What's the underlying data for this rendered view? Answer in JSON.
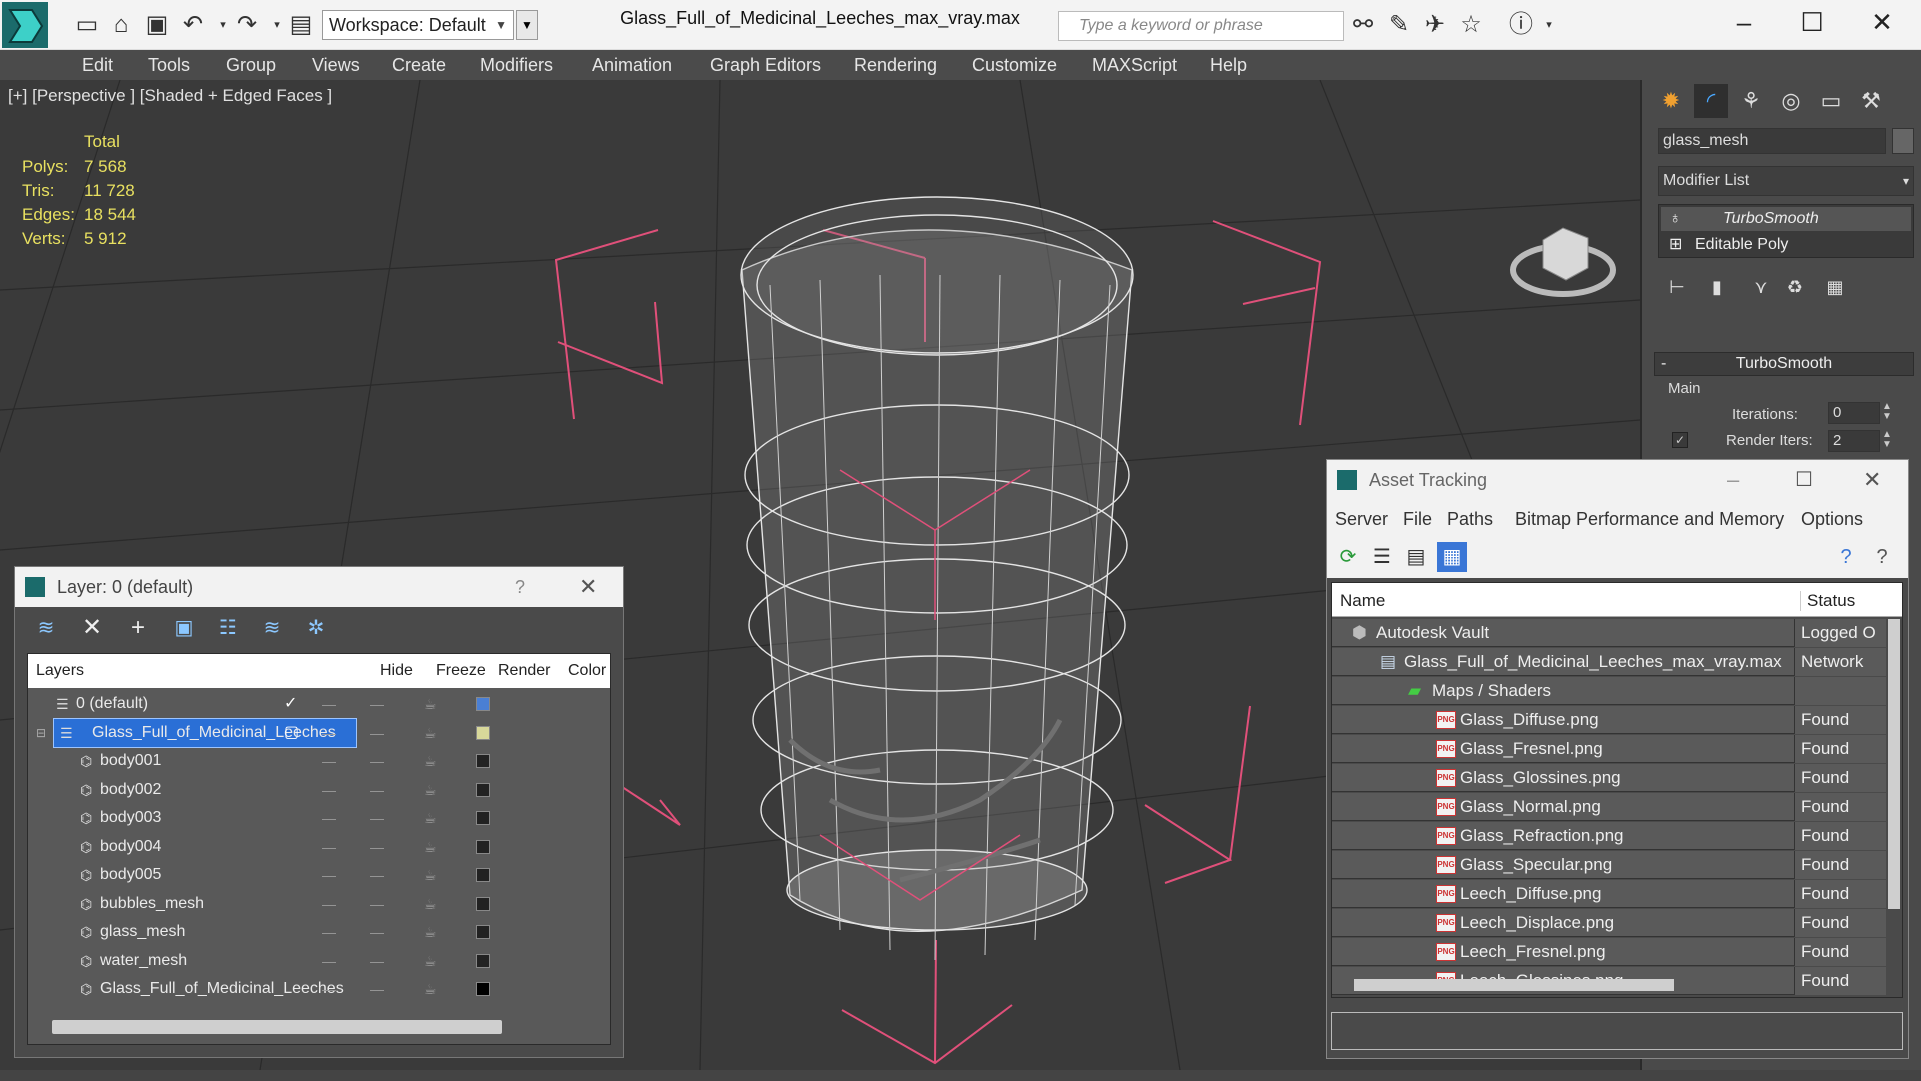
{
  "window": {
    "title": "Glass_Full_of_Medicinal_Leeches_max_vray.max",
    "workspace_label": "Workspace: Default",
    "search_placeholder": "Type a keyword or phrase"
  },
  "menu": [
    "Edit",
    "Tools",
    "Group",
    "Views",
    "Create",
    "Modifiers",
    "Animation",
    "Graph Editors",
    "Rendering",
    "Customize",
    "MAXScript",
    "Help"
  ],
  "viewport": {
    "label": "[+] [Perspective ] [Shaded + Edged Faces ]",
    "stats": {
      "header": "Total",
      "polys_label": "Polys:",
      "polys": "7 568",
      "tris_label": "Tris:",
      "tris": "11 728",
      "edges_label": "Edges:",
      "edges": "18 544",
      "verts_label": "Verts:",
      "verts": "5 912"
    }
  },
  "command_panel": {
    "object_name": "glass_mesh",
    "modifier_list": "Modifier List",
    "stack": [
      "TurboSmooth",
      "Editable Poly"
    ],
    "rollout_title": "TurboSmooth",
    "group_main": "Main",
    "iterations_label": "Iterations:",
    "iterations": "0",
    "render_iters_label": "Render Iters:",
    "render_iters": "2"
  },
  "layer_dialog": {
    "title": "Layer: 0 (default)",
    "help": "?",
    "columns": {
      "layers": "Layers",
      "hide": "Hide",
      "freeze": "Freeze",
      "render": "Render",
      "color": "Color"
    },
    "rows": [
      {
        "name": "0 (default)",
        "color": "#4a7fd4"
      },
      {
        "name": "Glass_Full_of_Medicinal_Leeches",
        "color": "#d8d89a"
      },
      {
        "name": "body001",
        "color": "#222222"
      },
      {
        "name": "body002",
        "color": "#222222"
      },
      {
        "name": "body003",
        "color": "#222222"
      },
      {
        "name": "body004",
        "color": "#222222"
      },
      {
        "name": "body005",
        "color": "#222222"
      },
      {
        "name": "bubbles_mesh",
        "color": "#222222"
      },
      {
        "name": "glass_mesh",
        "color": "#222222"
      },
      {
        "name": "water_mesh",
        "color": "#222222"
      },
      {
        "name": "Glass_Full_of_Medicinal_Leeches",
        "color": "#000000"
      }
    ]
  },
  "asset_dialog": {
    "title": "Asset Tracking",
    "menu": [
      "Server",
      "File",
      "Paths",
      "Bitmap Performance and Memory",
      "Options"
    ],
    "col_name": "Name",
    "col_status": "Status",
    "rows": [
      {
        "name": "Autodesk Vault",
        "status": "Logged O",
        "indent": 0,
        "kind": "vault"
      },
      {
        "name": "Glass_Full_of_Medicinal_Leeches_max_vray.max",
        "status": "Network",
        "indent": 1,
        "kind": "max"
      },
      {
        "name": "Maps / Shaders",
        "status": "",
        "indent": 2,
        "kind": "maps"
      },
      {
        "name": "Glass_Diffuse.png",
        "status": "Found",
        "indent": 3,
        "kind": "png"
      },
      {
        "name": "Glass_Fresnel.png",
        "status": "Found",
        "indent": 3,
        "kind": "png"
      },
      {
        "name": "Glass_Glossines.png",
        "status": "Found",
        "indent": 3,
        "kind": "png"
      },
      {
        "name": "Glass_Normal.png",
        "status": "Found",
        "indent": 3,
        "kind": "png"
      },
      {
        "name": "Glass_Refraction.png",
        "status": "Found",
        "indent": 3,
        "kind": "png"
      },
      {
        "name": "Glass_Specular.png",
        "status": "Found",
        "indent": 3,
        "kind": "png"
      },
      {
        "name": "Leech_Diffuse.png",
        "status": "Found",
        "indent": 3,
        "kind": "png"
      },
      {
        "name": "Leech_Displace.png",
        "status": "Found",
        "indent": 3,
        "kind": "png"
      },
      {
        "name": "Leech_Fresnel.png",
        "status": "Found",
        "indent": 3,
        "kind": "png"
      },
      {
        "name": "Leech_Glossines.png",
        "status": "Found",
        "indent": 3,
        "kind": "png"
      }
    ]
  },
  "colors": {
    "viewport_bg": "#3a3a3a",
    "stats_text": "#e8e060",
    "selection_blue": "#2a6fd6",
    "bracket_pink": "#e0507a"
  }
}
